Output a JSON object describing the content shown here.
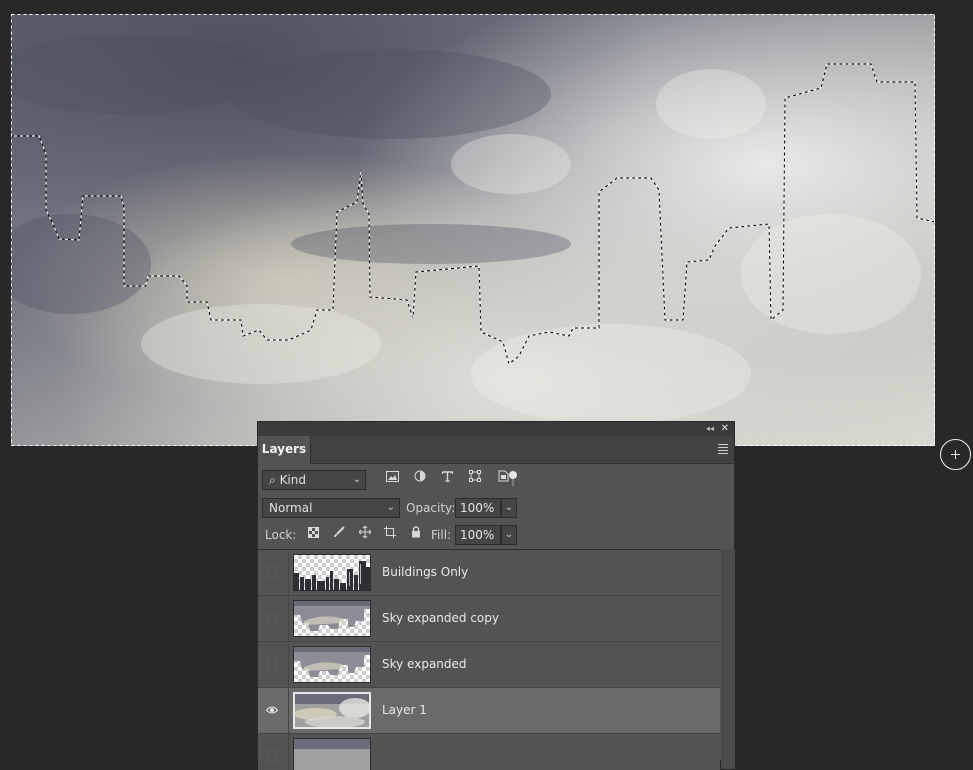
{
  "panel": {
    "tab_label": "Layers",
    "collapse_glyph": "◂◂",
    "close_glyph": "✕",
    "menu_icon": "hamburger-menu-icon"
  },
  "filter": {
    "kind_label": "Kind",
    "search_icon": "⌕",
    "filter_icons": [
      "pixel-layer-filter-icon",
      "adjustment-layer-filter-icon",
      "type-layer-filter-icon",
      "shape-layer-filter-icon",
      "smart-object-filter-icon"
    ]
  },
  "blend": {
    "mode": "Normal",
    "opacity_label": "Opacity:",
    "opacity_value": "100%"
  },
  "lock": {
    "label": "Lock:",
    "icons": [
      "lock-transparent-pixels-icon",
      "lock-image-pixels-icon",
      "lock-position-icon",
      "lock-artboard-icon",
      "lock-all-icon"
    ],
    "fill_label": "Fill:",
    "fill_value": "100%"
  },
  "layers": [
    {
      "name": "Buildings Only",
      "visible": false,
      "selected": false,
      "thumb": "buildings"
    },
    {
      "name": "Sky expanded copy",
      "visible": false,
      "selected": false,
      "thumb": "sky-masked"
    },
    {
      "name": "Sky expanded",
      "visible": false,
      "selected": false,
      "thumb": "sky-masked"
    },
    {
      "name": "Layer 1",
      "visible": true,
      "selected": true,
      "thumb": "sky"
    },
    {
      "name": "",
      "visible": false,
      "selected": false,
      "thumb": "sky"
    }
  ],
  "colors": {
    "workspace": "#282828",
    "panel": "#535353",
    "selected_row": "#6a6a6a"
  }
}
